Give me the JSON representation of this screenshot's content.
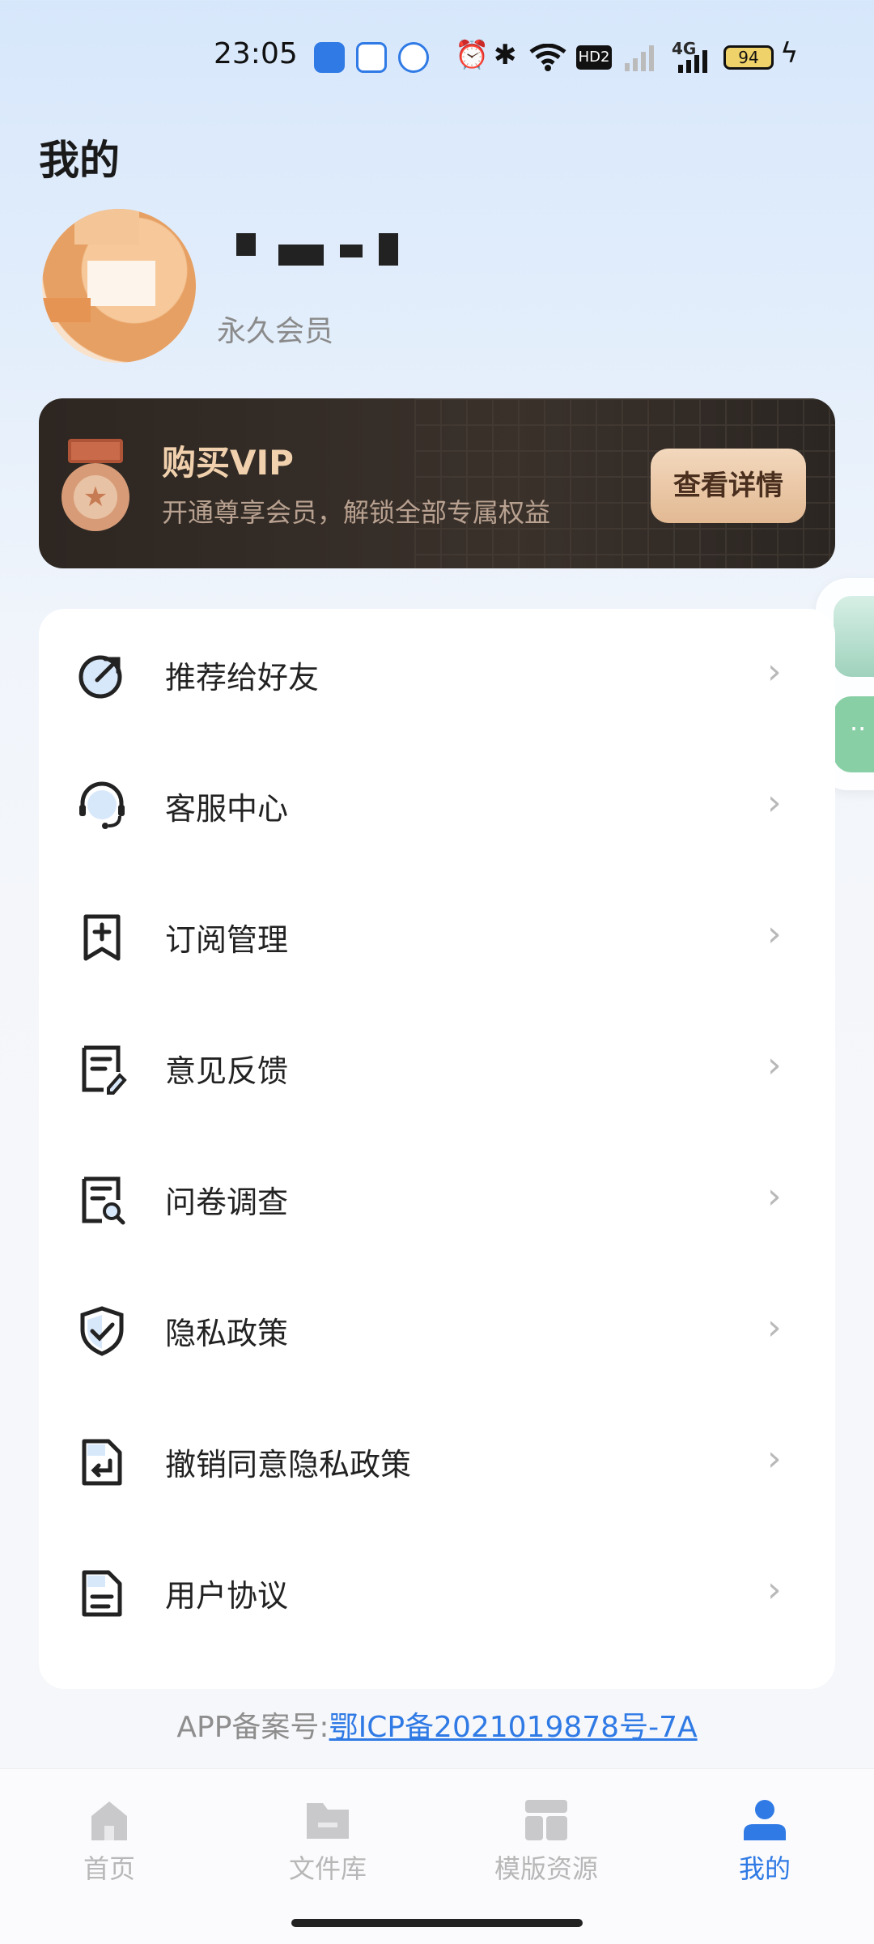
{
  "status_bar": {
    "time": "23:05",
    "hd_label": "HD2",
    "network_label": "4G",
    "battery": "94"
  },
  "header": {
    "title": "我的"
  },
  "profile": {
    "member_status": "永久会员"
  },
  "vip_banner": {
    "title": "购买VIP",
    "subtitle": "开通尊享会员，解锁全部专属权益",
    "button": "查看详情"
  },
  "menu": {
    "items": [
      {
        "label": "推荐给好友",
        "icon": "share-icon"
      },
      {
        "label": "客服中心",
        "icon": "headset-icon"
      },
      {
        "label": "订阅管理",
        "icon": "bookmark-add-icon"
      },
      {
        "label": "意见反馈",
        "icon": "feedback-edit-icon"
      },
      {
        "label": "问卷调查",
        "icon": "survey-search-icon"
      },
      {
        "label": "隐私政策",
        "icon": "shield-check-icon"
      },
      {
        "label": "撤销同意隐私政策",
        "icon": "document-return-icon"
      },
      {
        "label": "用户协议",
        "icon": "document-icon"
      }
    ]
  },
  "icp": {
    "prefix": "APP备案号:",
    "number": "鄂ICP备2021019878号-7A"
  },
  "bottom_nav": {
    "items": [
      {
        "label": "首页",
        "icon": "home-icon"
      },
      {
        "label": "文件库",
        "icon": "folder-icon"
      },
      {
        "label": "模版资源",
        "icon": "template-icon"
      },
      {
        "label": "我的",
        "icon": "user-icon",
        "active": true
      }
    ]
  },
  "colors": {
    "accent": "#2f7ae5",
    "vip_gold": "#f1d1ad",
    "banner_bg": "#2d2621"
  }
}
